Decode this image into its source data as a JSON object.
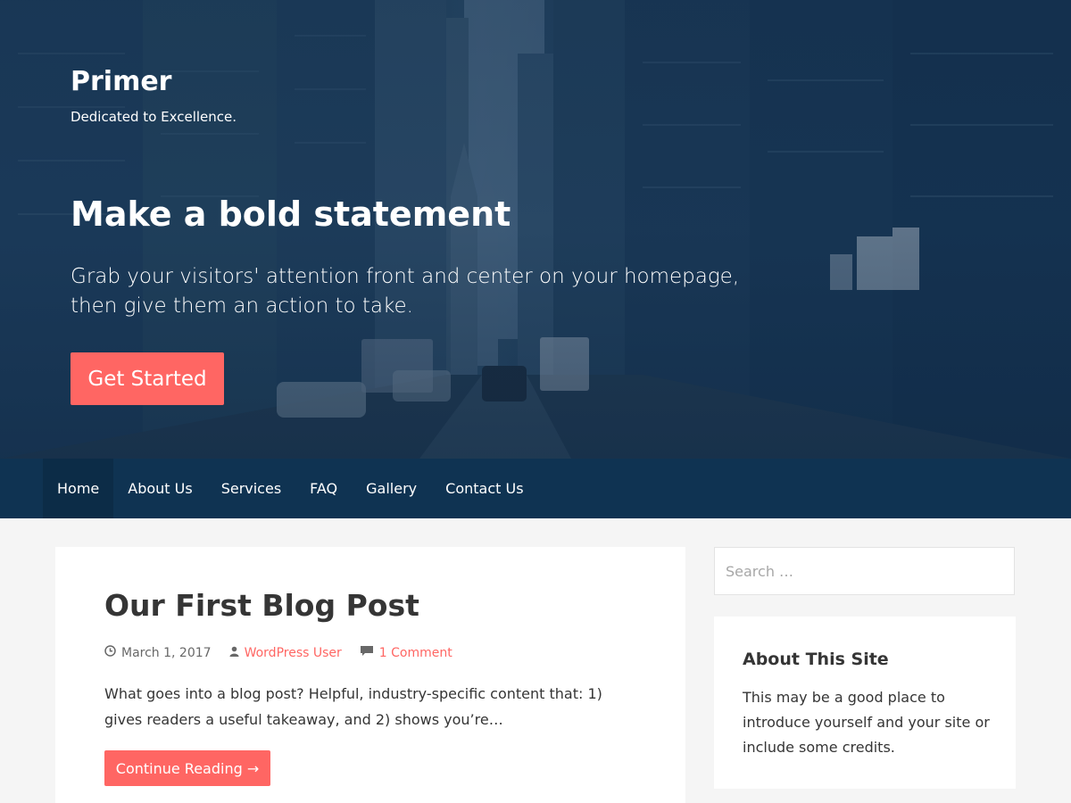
{
  "colors": {
    "accent": "#ff6663",
    "nav_background": "#0f3352",
    "hero_overlay": "#17365a",
    "page_background": "#f5f5f5",
    "text": "#353535"
  },
  "hero": {
    "site_title": "Primer",
    "tagline": "Dedicated to Excellence.",
    "heading": "Make a bold statement",
    "text": "Grab your visitors' attention front and center on your homepage, then give them an action to take.",
    "button_label": "Get Started"
  },
  "nav": {
    "items": [
      {
        "label": "Home",
        "active": true
      },
      {
        "label": "About Us",
        "active": false
      },
      {
        "label": "Services",
        "active": false
      },
      {
        "label": "FAQ",
        "active": false
      },
      {
        "label": "Gallery",
        "active": false
      },
      {
        "label": "Contact Us",
        "active": false
      }
    ]
  },
  "post": {
    "title": "Our First Blog Post",
    "date": "March 1, 2017",
    "author": "WordPress User",
    "comments": "1 Comment",
    "excerpt": "What goes into a blog post? Helpful, industry-specific content that: 1) gives readers a useful takeaway, and 2) shows you’re…",
    "continue_label": "Continue Reading →",
    "icons": {
      "date": "clock-icon",
      "author": "user-icon",
      "comments": "comment-icon"
    }
  },
  "sidebar": {
    "search_placeholder": "Search …",
    "widget": {
      "title": "About This Site",
      "text": "This may be a good place to introduce yourself and your site or include some credits."
    }
  }
}
